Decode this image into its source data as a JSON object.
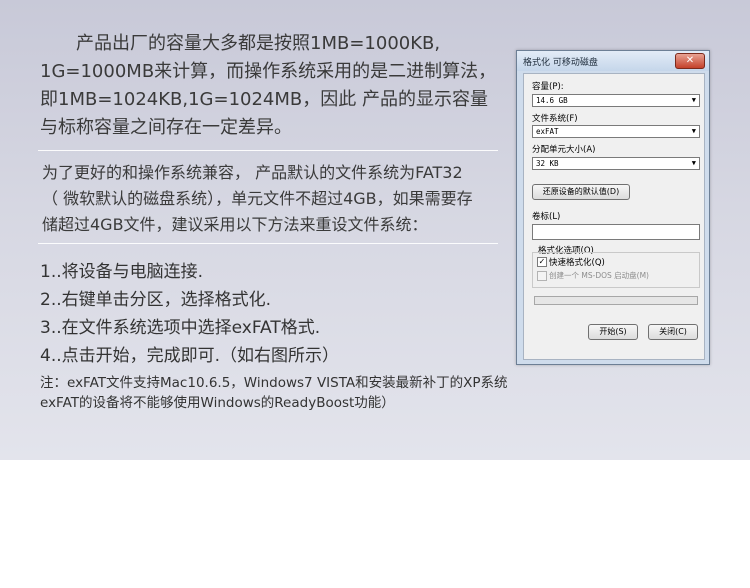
{
  "intro": {
    "lines": [
      "产品出厂的容量大多都是按照1MB=1000KB,",
      "1G=1000MB来计算，而操作系统采用的是二进制算法，",
      "即1MB=1024KB,1G=1024MB，因此 产品的显示容量",
      "与标称容量之间存在一定差异。"
    ]
  },
  "compat": {
    "lines": [
      "为了更好的和操作系统兼容， 产品默认的文件系统为FAT32",
      "（ 微软默认的磁盘系统），单元文件不超过4GB，如果需要存",
      "储超过4GB文件，建议采用以下方法来重设文件系统："
    ]
  },
  "steps": [
    "1..将设备与电脑连接.",
    "2..右键单击分区，选择格式化.",
    "3..在文件系统选项中选择exFAT格式.",
    "4..点击开始，完成即可.（如右图所示）"
  ],
  "note": {
    "lines": [
      "注：exFAT文件支持Mac10.6.5，Windows7  VISTA和安装最新补丁的XP系统",
      "exFAT的设备将不能够使用Windows的ReadyBoost功能）"
    ]
  },
  "dialog": {
    "title": "格式化 可移动磁盘",
    "close": "✕",
    "capacity_label": "容量(P):",
    "capacity_value": "14.6 GB",
    "fs_label": "文件系统(F)",
    "fs_value": "exFAT",
    "alloc_label": "分配单元大小(A)",
    "alloc_value": "32 KB",
    "restore_button": "还原设备的默认值(D)",
    "volume_label": "卷标(L)",
    "volume_value": "",
    "options_label": "格式化选项(O)",
    "quick_format": "快速格式化(Q)",
    "msdos": "创建一个 MS-DOS 启动盘(M)",
    "start_button": "开始(S)",
    "close_button": "关闭(C)",
    "dropdown_arrow": "▼"
  }
}
